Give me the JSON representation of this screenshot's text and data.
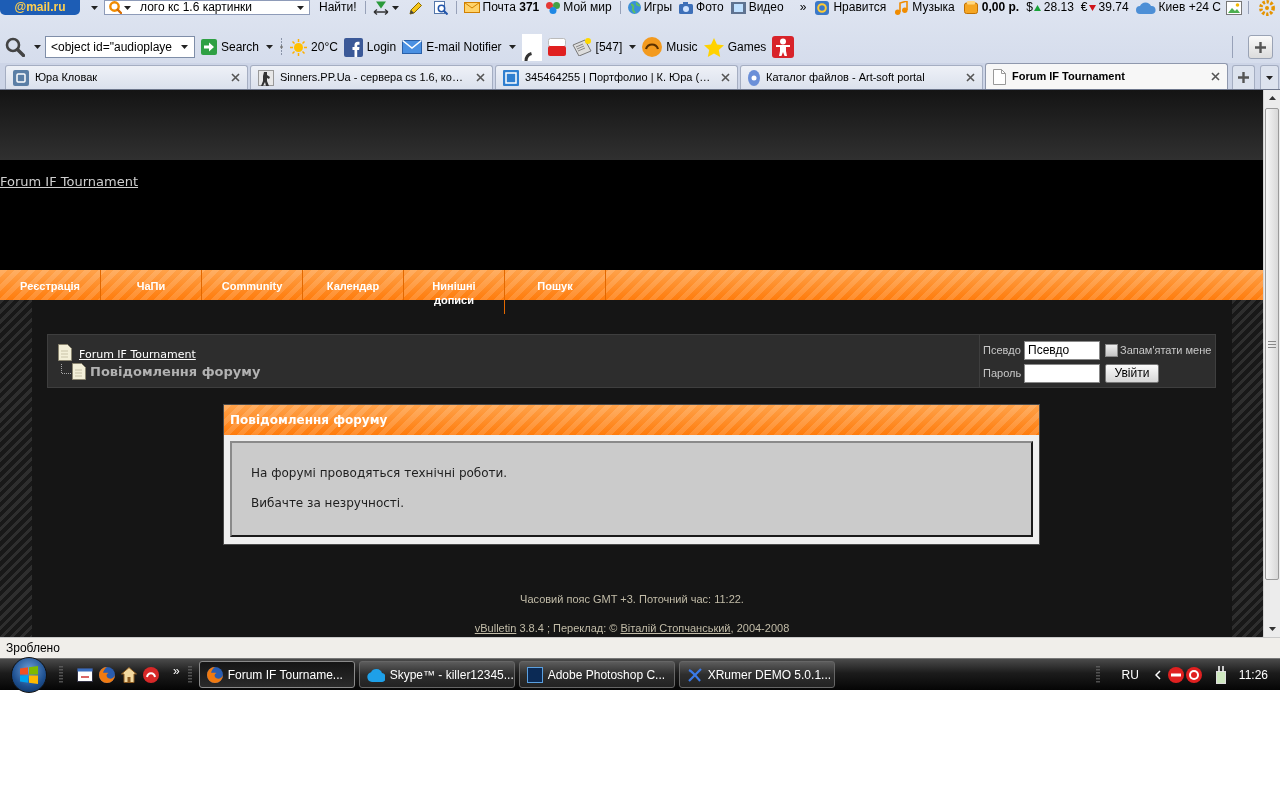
{
  "mailru_toolbar": {
    "logo": "@mail.ru",
    "search": {
      "value": "лого кс 1.6 картинки"
    },
    "search_button": "Найти!",
    "links": [
      {
        "label": "Почта **371**"
      },
      {
        "label": "Мой мир"
      },
      {
        "label": "Игры"
      },
      {
        "label": "Фото"
      },
      {
        "label": "Видео"
      }
    ],
    "more": "»",
    "extras": [
      {
        "kind": "link",
        "label": "Нравится"
      },
      {
        "kind": "link",
        "label": "Музыка"
      },
      {
        "kind": "balance",
        "label": "0,00 р."
      }
    ],
    "rates": [
      {
        "currency": "$",
        "value": "28.13",
        "rising": true
      },
      {
        "currency": "€",
        "value": "39.74",
        "rising": false
      }
    ],
    "weather": "Киев +24 С"
  },
  "browser_toolbar": {
    "combo_field": {
      "value": "<object id=\"audioplaye"
    },
    "items": [
      {
        "kind": "button",
        "label": "Search",
        "has_menu": true
      },
      {
        "kind": "button",
        "label": "20°C",
        "has_menu": false
      },
      {
        "kind": "button",
        "label": "Login",
        "has_menu": false
      },
      {
        "kind": "button",
        "label": "E-mail Notifier",
        "has_menu": true
      },
      {
        "kind": "icon",
        "has_menu": false
      },
      {
        "kind": "icon",
        "has_menu": false
      },
      {
        "kind": "button",
        "label": "[547]",
        "has_menu": true
      },
      {
        "kind": "button",
        "label": "Music",
        "has_menu": false
      },
      {
        "kind": "button",
        "label": "Games",
        "has_menu": false
      },
      {
        "kind": "icon",
        "has_menu": false
      }
    ]
  },
  "tabs": [
    {
      "title": "Юра Кловак",
      "selected": false
    },
    {
      "title": "Sinners.PP.Ua - сервера cs 1.6, ко…",
      "selected": false
    },
    {
      "title": "345464255 | Портфолио | К. Юра (…",
      "selected": false
    },
    {
      "title": "Каталог файлов - Art-soft portal",
      "selected": false
    },
    {
      "title": "Forum IF Tournament",
      "selected": true
    }
  ],
  "page": {
    "site_link": "Forum IF Tournament",
    "nav": [
      "Реєстрація",
      "ЧаПи",
      "Community",
      "Календар",
      "Нинішні дописи",
      "Пошук"
    ],
    "breadcrumb": {
      "parent": "Forum IF Tournament",
      "current": "Повідомлення форуму"
    },
    "login": {
      "username_label": "Псевдо",
      "username_value": "Псевдо",
      "remember": {
        "label": "Запам'ятати мене",
        "checked": false
      },
      "password_label": "Пароль",
      "submit": "Увійти"
    },
    "notice": {
      "title": "Повідомлення форуму",
      "lines": [
        "На форумі проводяться технічні роботи.",
        "Вибачте за незручності."
      ]
    },
    "footer": {
      "timezone": "Часовий пояс GMT +3. Поточний час: 11:22.",
      "credits": [
        {
          "text": "vBulletin",
          "link": true
        },
        {
          "text": " 3.8.4 ; Переклад: © ",
          "link": false
        },
        {
          "text": "Віталій Стопчанський",
          "link": true
        },
        {
          "text": ", 2004-2008",
          "link": false
        }
      ]
    }
  },
  "status_bar": {
    "text": "Зроблено"
  },
  "taskbar": {
    "more": "»",
    "tasks": [
      {
        "label": "Forum IF Tourname...",
        "selected": true
      },
      {
        "label": "Skype™ - killer12345...",
        "selected": false
      },
      {
        "label": "Adobe Photoshop C...",
        "selected": false
      },
      {
        "label": "XRumer DEMO 5.0.1...",
        "selected": false
      }
    ],
    "language": "RU",
    "clock": "11:26"
  }
}
